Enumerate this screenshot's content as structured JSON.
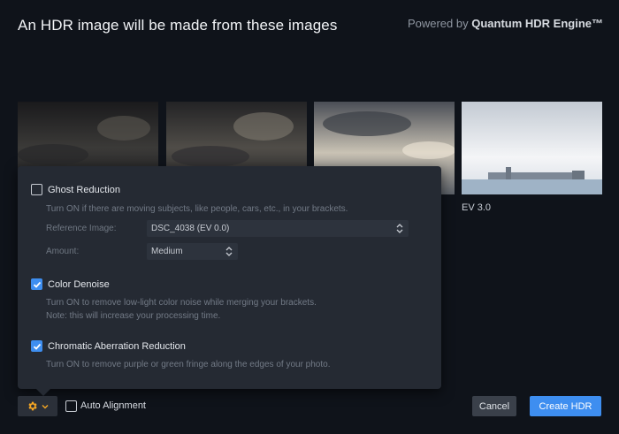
{
  "header": {
    "title": "An HDR image will be made from these images",
    "powered_prefix": "Powered by ",
    "powered_brand": "Quantum HDR Engine™"
  },
  "thumbnails": [
    {
      "name": "thumb-1",
      "label": ""
    },
    {
      "name": "thumb-2",
      "label": ""
    },
    {
      "name": "thumb-3",
      "label": ""
    },
    {
      "name": "thumb-4",
      "label": "EV 3.0"
    }
  ],
  "options": {
    "ghost": {
      "label": "Ghost Reduction",
      "checked": false,
      "desc": "Turn ON if there are moving subjects, like people, cars, etc., in your brackets.",
      "reference_label": "Reference Image:",
      "reference_value": "DSC_4038 (EV 0.0)",
      "amount_label": "Amount:",
      "amount_value": "Medium"
    },
    "denoise": {
      "label": "Color Denoise",
      "checked": true,
      "desc1": "Turn ON to remove low-light color noise while merging your brackets.",
      "desc2": "Note: this will increase your processing time."
    },
    "chromatic": {
      "label": "Chromatic Aberration Reduction",
      "checked": true,
      "desc": "Turn ON to remove purple or green fringe along the edges of your photo."
    }
  },
  "footer": {
    "auto_alignment_label": "Auto Alignment",
    "auto_alignment_checked": false,
    "cancel_label": "Cancel",
    "create_label": "Create HDR"
  },
  "colors": {
    "accent": "#3e8ef0",
    "background": "#0f131a",
    "panel": "#252a33"
  },
  "icons": {
    "settings": "gear-icon",
    "dropdown": "chevron-down-icon",
    "select": "updown-arrows-icon",
    "check": "checkmark-icon"
  }
}
